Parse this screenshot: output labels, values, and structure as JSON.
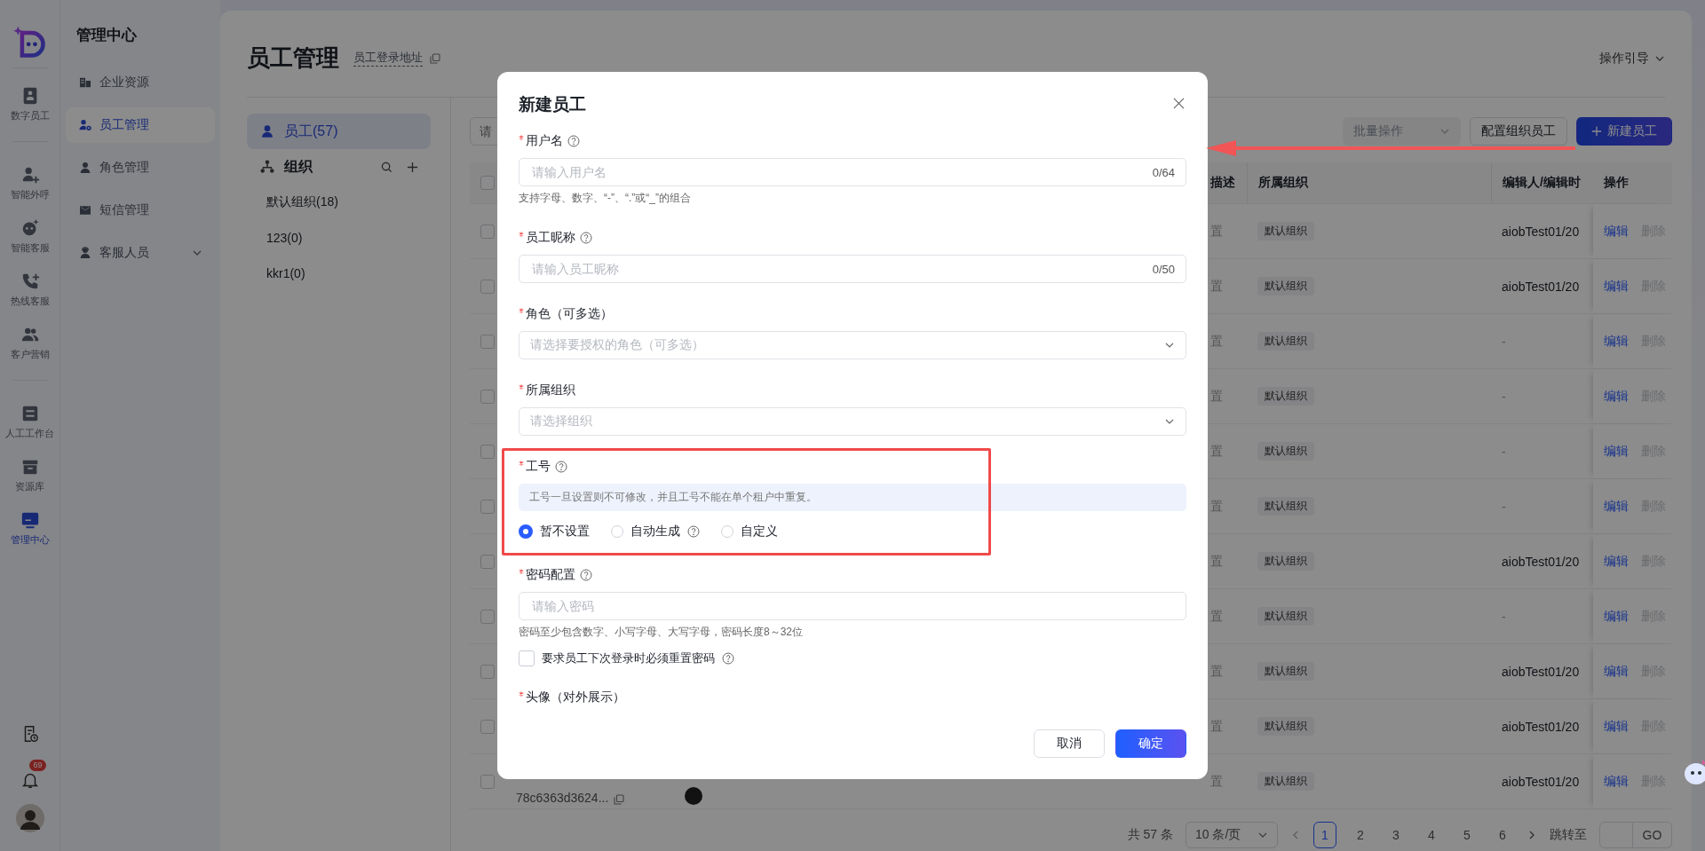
{
  "nav_rail": {
    "groups": [
      [
        {
          "label": "数字员工",
          "selected": false
        }
      ],
      [
        {
          "label": "智能外呼",
          "selected": false
        },
        {
          "label": "智能客服",
          "selected": false
        },
        {
          "label": "热线客服",
          "selected": false
        },
        {
          "label": "客户营销",
          "selected": false
        }
      ],
      [
        {
          "label": "人工工作台",
          "selected": false
        },
        {
          "label": "资源库",
          "selected": false
        },
        {
          "label": "管理中心",
          "selected": true
        }
      ]
    ],
    "notification_count": "69"
  },
  "side_menu": {
    "title": "管理中心",
    "items": [
      {
        "label": "企业资源",
        "selected": false,
        "kind": "page"
      },
      {
        "label": "员工管理",
        "selected": true,
        "kind": "page"
      },
      {
        "label": "角色管理",
        "selected": false,
        "kind": "page"
      },
      {
        "label": "短信管理",
        "selected": false,
        "kind": "page"
      },
      {
        "label": "客服人员",
        "selected": false,
        "kind": "group"
      }
    ]
  },
  "page": {
    "title": "员工管理",
    "login_link": "员工登录地址",
    "guide": "操作引导"
  },
  "org_panel": {
    "employees": {
      "label": "员工(57)",
      "selected": true
    },
    "org_title": "组织",
    "orgs": [
      {
        "label": "默认组织(18)",
        "selected": false
      },
      {
        "label": "123(0)",
        "selected": false
      },
      {
        "label": "kkr1(0)",
        "selected": false
      }
    ]
  },
  "toolbar": {
    "search_placeholder": "请",
    "batch": {
      "label": "批量操作",
      "disabled": true
    },
    "config": "配置组织员工",
    "create": "新建员工"
  },
  "table": {
    "header_checked": false,
    "columns": [
      "描述",
      "所属组织",
      "编辑人/编辑时",
      "操作"
    ],
    "rows": [
      {
        "checked": false,
        "description": "置",
        "org": "默认组织",
        "editor": "aiobTest01/20",
        "edit": "编辑",
        "delete": "删除"
      },
      {
        "checked": false,
        "description": "置",
        "org": "默认组织",
        "editor": "aiobTest01/20",
        "edit": "编辑",
        "delete": "删除"
      },
      {
        "checked": false,
        "description": "置",
        "org": "默认组织",
        "editor": "-",
        "edit": "编辑",
        "delete": "删除"
      },
      {
        "checked": false,
        "description": "置",
        "org": "默认组织",
        "editor": "-",
        "edit": "编辑",
        "delete": "删除"
      },
      {
        "checked": false,
        "description": "置",
        "org": "默认组织",
        "editor": "-",
        "edit": "编辑",
        "delete": "删除"
      },
      {
        "checked": false,
        "description": "置",
        "org": "默认组织",
        "editor": "-",
        "edit": "编辑",
        "delete": "删除"
      },
      {
        "checked": false,
        "description": "置",
        "org": "默认组织",
        "editor": "aiobTest01/20",
        "edit": "编辑",
        "delete": "删除"
      },
      {
        "checked": false,
        "description": "置",
        "org": "默认组织",
        "editor": "-",
        "edit": "编辑",
        "delete": "删除"
      },
      {
        "checked": false,
        "description": "置",
        "org": "默认组织",
        "editor": "aiobTest01/20",
        "edit": "编辑",
        "delete": "删除"
      },
      {
        "checked": false,
        "description": "置",
        "org": "默认组织",
        "editor": "aiobTest01/20",
        "edit": "编辑",
        "delete": "删除"
      },
      {
        "checked": false,
        "id": "78c6363d3624...",
        "description": "置",
        "org": "默认组织",
        "editor": "aiobTest01/20",
        "edit": "编辑",
        "delete": "删除"
      }
    ],
    "delete_disabled": true
  },
  "pagination": {
    "total": "共 57 条",
    "page_size": "10 条/页",
    "pages": [
      {
        "label": "1",
        "selected": true
      },
      {
        "label": "2",
        "selected": false
      },
      {
        "label": "3",
        "selected": false
      },
      {
        "label": "4",
        "selected": false
      },
      {
        "label": "5",
        "selected": false
      },
      {
        "label": "6",
        "selected": false
      }
    ],
    "jump_label": "跳转至",
    "go": "GO"
  },
  "dialog": {
    "title": "新建员工",
    "fields": [
      {
        "kind": "text",
        "label": "用户名",
        "required": true,
        "help": true,
        "highlighted": false,
        "placeholder": "请输入用户名",
        "counter": "0/64",
        "hint": "支持字母、数字、“-”、“.”或“_”的组合"
      },
      {
        "kind": "text",
        "label": "员工昵称",
        "required": true,
        "help": true,
        "highlighted": false,
        "placeholder": "请输入员工昵称",
        "counter": "0/50"
      },
      {
        "kind": "select",
        "label": "角色（可多选）",
        "required": true,
        "help": false,
        "highlighted": false,
        "placeholder": "请选择要授权的角色（可多选）"
      },
      {
        "kind": "select",
        "label": "所属组织",
        "required": true,
        "help": false,
        "highlighted": false,
        "placeholder": "请选择组织"
      },
      {
        "kind": "radio",
        "label": "工号",
        "required": true,
        "help": true,
        "highlighted": true,
        "notice": "工号一旦设置则不可修改，并且工号不能在单个租户中重复。",
        "options": [
          {
            "label": "暂不设置",
            "selected": true,
            "help": false
          },
          {
            "label": "自动生成",
            "selected": false,
            "help": true
          },
          {
            "label": "自定义",
            "selected": false,
            "help": false
          }
        ]
      },
      {
        "kind": "password",
        "label": "密码配置",
        "required": true,
        "help": true,
        "highlighted": false,
        "placeholder": "请输入密码",
        "hint": "密码至少包含数字、小写字母、大写字母，密码长度8～32位",
        "checkbox": {
          "label": "要求员工下次登录时必须重置密码",
          "checked": false,
          "help": true
        }
      },
      {
        "kind": "upload",
        "label": "头像（对外展示）",
        "required": true,
        "help": false,
        "highlighted": false
      }
    ],
    "cancel": "取消",
    "confirm": "确定"
  },
  "annotations": {
    "arrow_to_create_button": true
  }
}
